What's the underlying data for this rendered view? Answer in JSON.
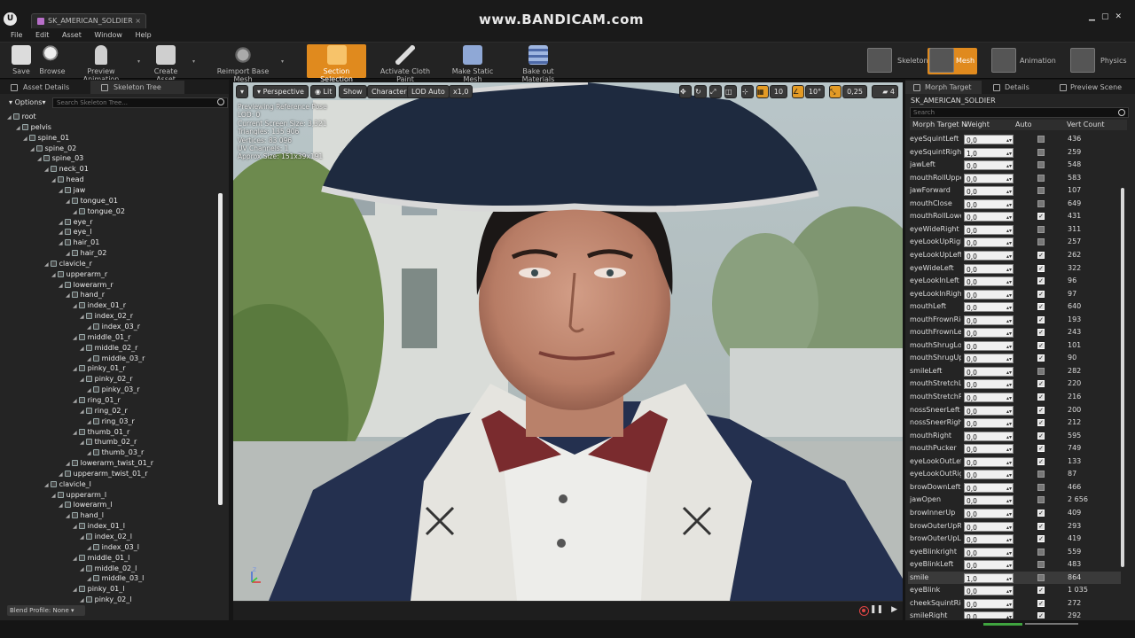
{
  "window": {
    "tab_title": "SK_AMERICAN_SOLDIER",
    "watermark": "www.BANDICAM.com",
    "logo": "U"
  },
  "menu": [
    "File",
    "Edit",
    "Asset",
    "Window",
    "Help"
  ],
  "toolbar": {
    "save": "Save",
    "browse": "Browse",
    "preview_animation": "Preview Animation",
    "create_asset": "Create Asset",
    "reimport": "Reimport Base Mesh",
    "section_selection": "Section Selection",
    "cloth_paint": "Activate Cloth Paint",
    "static_mesh": "Make Static Mesh",
    "bake_materials": "Bake out Materials",
    "modes": {
      "skeleton": "Skeleton",
      "mesh": "Mesh",
      "animation": "Animation",
      "physics": "Physics"
    }
  },
  "left_panel": {
    "tab_asset_details": "Asset Details",
    "tab_skeleton_tree": "Skeleton Tree",
    "options": "Options",
    "search_placeholder": "Search Skeleton Tree...",
    "blend_profile": "Blend Profile: None",
    "bones": [
      {
        "name": "root",
        "depth": 0
      },
      {
        "name": "pelvis",
        "depth": 1
      },
      {
        "name": "spine_01",
        "depth": 2
      },
      {
        "name": "spine_02",
        "depth": 3
      },
      {
        "name": "spine_03",
        "depth": 4
      },
      {
        "name": "neck_01",
        "depth": 5
      },
      {
        "name": "head",
        "depth": 6
      },
      {
        "name": "jaw",
        "depth": 7
      },
      {
        "name": "tongue_01",
        "depth": 8
      },
      {
        "name": "tongue_02",
        "depth": 9
      },
      {
        "name": "eye_r",
        "depth": 7
      },
      {
        "name": "eye_l",
        "depth": 7
      },
      {
        "name": "hair_01",
        "depth": 7
      },
      {
        "name": "hair_02",
        "depth": 8
      },
      {
        "name": "clavicle_r",
        "depth": 5
      },
      {
        "name": "upperarm_r",
        "depth": 6
      },
      {
        "name": "lowerarm_r",
        "depth": 7
      },
      {
        "name": "hand_r",
        "depth": 8
      },
      {
        "name": "index_01_r",
        "depth": 9
      },
      {
        "name": "index_02_r",
        "depth": 10
      },
      {
        "name": "index_03_r",
        "depth": 11
      },
      {
        "name": "middle_01_r",
        "depth": 9
      },
      {
        "name": "middle_02_r",
        "depth": 10
      },
      {
        "name": "middle_03_r",
        "depth": 11
      },
      {
        "name": "pinky_01_r",
        "depth": 9
      },
      {
        "name": "pinky_02_r",
        "depth": 10
      },
      {
        "name": "pinky_03_r",
        "depth": 11
      },
      {
        "name": "ring_01_r",
        "depth": 9
      },
      {
        "name": "ring_02_r",
        "depth": 10
      },
      {
        "name": "ring_03_r",
        "depth": 11
      },
      {
        "name": "thumb_01_r",
        "depth": 9
      },
      {
        "name": "thumb_02_r",
        "depth": 10
      },
      {
        "name": "thumb_03_r",
        "depth": 11
      },
      {
        "name": "lowerarm_twist_01_r",
        "depth": 8
      },
      {
        "name": "upperarm_twist_01_r",
        "depth": 7
      },
      {
        "name": "clavicle_l",
        "depth": 5
      },
      {
        "name": "upperarm_l",
        "depth": 6
      },
      {
        "name": "lowerarm_l",
        "depth": 7
      },
      {
        "name": "hand_l",
        "depth": 8
      },
      {
        "name": "index_01_l",
        "depth": 9
      },
      {
        "name": "index_02_l",
        "depth": 10
      },
      {
        "name": "index_03_l",
        "depth": 11
      },
      {
        "name": "middle_01_l",
        "depth": 9
      },
      {
        "name": "middle_02_l",
        "depth": 10
      },
      {
        "name": "middle_03_l",
        "depth": 11
      },
      {
        "name": "pinky_01_l",
        "depth": 9
      },
      {
        "name": "pinky_02_l",
        "depth": 10
      }
    ]
  },
  "viewport": {
    "menu": "▾",
    "perspective": "Perspective",
    "lit": "Lit",
    "show": "Show",
    "character": "Character",
    "lod": "LOD Auto",
    "speed": "x1,0",
    "grid_snap": "10",
    "rot_snap": "10°",
    "scale_snap": "0,25",
    "cam_speed": "4",
    "info": [
      "Previewing Reference Pose",
      "LOD: 0",
      "Current Screen Size: 3,321",
      "Triangles: 135 906",
      "Vertices: 83 096",
      "UV Channels: 1",
      "Approx Size: 151x39x191"
    ],
    "axis_label": "Z"
  },
  "right_panel": {
    "tab_morph": "Morph Target",
    "tab_details": "Details",
    "tab_preview": "Preview Scene",
    "asset_name": "SK_AMERICAN_SOLDIER",
    "search_placeholder": "Search",
    "col_name": "Morph Target N",
    "col_weight": "Weight",
    "col_auto": "Auto",
    "col_vert": "Vert Count",
    "morphs": [
      {
        "name": "eyeSquintLeft",
        "weight": "0,0",
        "auto": false,
        "vc": "436"
      },
      {
        "name": "eyeSquintRight",
        "weight": "1,0",
        "auto": false,
        "vc": "259"
      },
      {
        "name": "jawLeft",
        "weight": "0,0",
        "auto": false,
        "vc": "548"
      },
      {
        "name": "mouthRollUpper",
        "weight": "0,0",
        "auto": false,
        "vc": "583"
      },
      {
        "name": "jawForward",
        "weight": "0,0",
        "auto": false,
        "vc": "107"
      },
      {
        "name": "mouthClose",
        "weight": "0,0",
        "auto": false,
        "vc": "649"
      },
      {
        "name": "mouthRollLower",
        "weight": "0,0",
        "auto": true,
        "vc": "431"
      },
      {
        "name": "eyeWideRight",
        "weight": "0,0",
        "auto": false,
        "vc": "311"
      },
      {
        "name": "eyeLookUpRight",
        "weight": "0,0",
        "auto": false,
        "vc": "257"
      },
      {
        "name": "eyeLookUpLeft",
        "weight": "0,0",
        "auto": true,
        "vc": "262"
      },
      {
        "name": "eyeWideLeft",
        "weight": "0,0",
        "auto": true,
        "vc": "322"
      },
      {
        "name": "eyeLookInLeft",
        "weight": "0,0",
        "auto": true,
        "vc": "96"
      },
      {
        "name": "eyeLookInRight",
        "weight": "0,0",
        "auto": true,
        "vc": "97"
      },
      {
        "name": "mouthLeft",
        "weight": "0,0",
        "auto": true,
        "vc": "640"
      },
      {
        "name": "mouthFrownRight",
        "weight": "0,0",
        "auto": true,
        "vc": "193"
      },
      {
        "name": "mouthFrownLeft",
        "weight": "0,0",
        "auto": true,
        "vc": "243"
      },
      {
        "name": "mouthShrugLower",
        "weight": "0,0",
        "auto": true,
        "vc": "101"
      },
      {
        "name": "mouthShrugUpper",
        "weight": "0,0",
        "auto": true,
        "vc": "90"
      },
      {
        "name": "smileLeft",
        "weight": "0,0",
        "auto": false,
        "vc": "282"
      },
      {
        "name": "mouthStretchLeft",
        "weight": "0,0",
        "auto": true,
        "vc": "220"
      },
      {
        "name": "mouthStretchRight",
        "weight": "0,0",
        "auto": true,
        "vc": "216"
      },
      {
        "name": "nossSneerLeft",
        "weight": "0,0",
        "auto": true,
        "vc": "200"
      },
      {
        "name": "nossSneerRight",
        "weight": "0,0",
        "auto": true,
        "vc": "212"
      },
      {
        "name": "mouthRight",
        "weight": "0,0",
        "auto": true,
        "vc": "595"
      },
      {
        "name": "mouthPucker",
        "weight": "0,0",
        "auto": true,
        "vc": "749"
      },
      {
        "name": "eyeLookOutLeft",
        "weight": "0,0",
        "auto": true,
        "vc": "133"
      },
      {
        "name": "eyeLookOutRight",
        "weight": "0,0",
        "auto": false,
        "vc": "87"
      },
      {
        "name": "browDownLeft",
        "weight": "0,0",
        "auto": false,
        "vc": "466"
      },
      {
        "name": "jawOpen",
        "weight": "0,0",
        "auto": false,
        "vc": "2 656"
      },
      {
        "name": "browInnerUp",
        "weight": "0,0",
        "auto": true,
        "vc": "409"
      },
      {
        "name": "browOuterUpRight",
        "weight": "0,0",
        "auto": true,
        "vc": "293"
      },
      {
        "name": "browOuterUpLeft",
        "weight": "0,0",
        "auto": true,
        "vc": "419"
      },
      {
        "name": "eyeBlinkright",
        "weight": "0,0",
        "auto": false,
        "vc": "559"
      },
      {
        "name": "eyeBlinkLeft",
        "weight": "0,0",
        "auto": false,
        "vc": "483"
      },
      {
        "name": "smile",
        "weight": "1,0",
        "auto": false,
        "vc": "864"
      },
      {
        "name": "eyeBlink",
        "weight": "0,0",
        "auto": true,
        "vc": "1 035"
      },
      {
        "name": "cheekSquintRight",
        "weight": "0,0",
        "auto": true,
        "vc": "272"
      },
      {
        "name": "smileRight",
        "weight": "0,0",
        "auto": true,
        "vc": "292"
      }
    ],
    "selected_index": 34
  }
}
